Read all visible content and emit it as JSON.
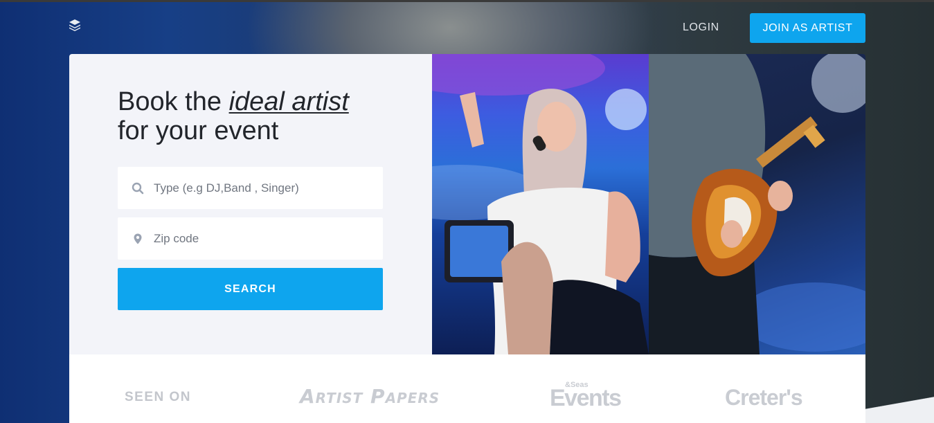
{
  "nav": {
    "login_label": "LOGIN",
    "join_label": "JOIN AS ARTIST",
    "logo_icon": "layers-icon"
  },
  "hero": {
    "headline_part1": "Book the ",
    "headline_emphasis": "ideal artist",
    "headline_part2": "for your event",
    "type_field": {
      "placeholder": "Type (e.g DJ,Band , Singer)",
      "value": "",
      "icon": "search-icon"
    },
    "zip_field": {
      "placeholder": "Zip code",
      "value": "",
      "icon": "location-pin-icon"
    },
    "search_label": "SEARCH"
  },
  "press": {
    "label": "SEEN ON",
    "brands": [
      "Artist Papers",
      "Events",
      "Creter's"
    ],
    "events_superscript": "&Seas"
  },
  "colors": {
    "accent": "#0ea5ee",
    "card_bg": "#f3f4f9",
    "headline": "#22252b",
    "muted_logo": "#c9ccd2"
  }
}
